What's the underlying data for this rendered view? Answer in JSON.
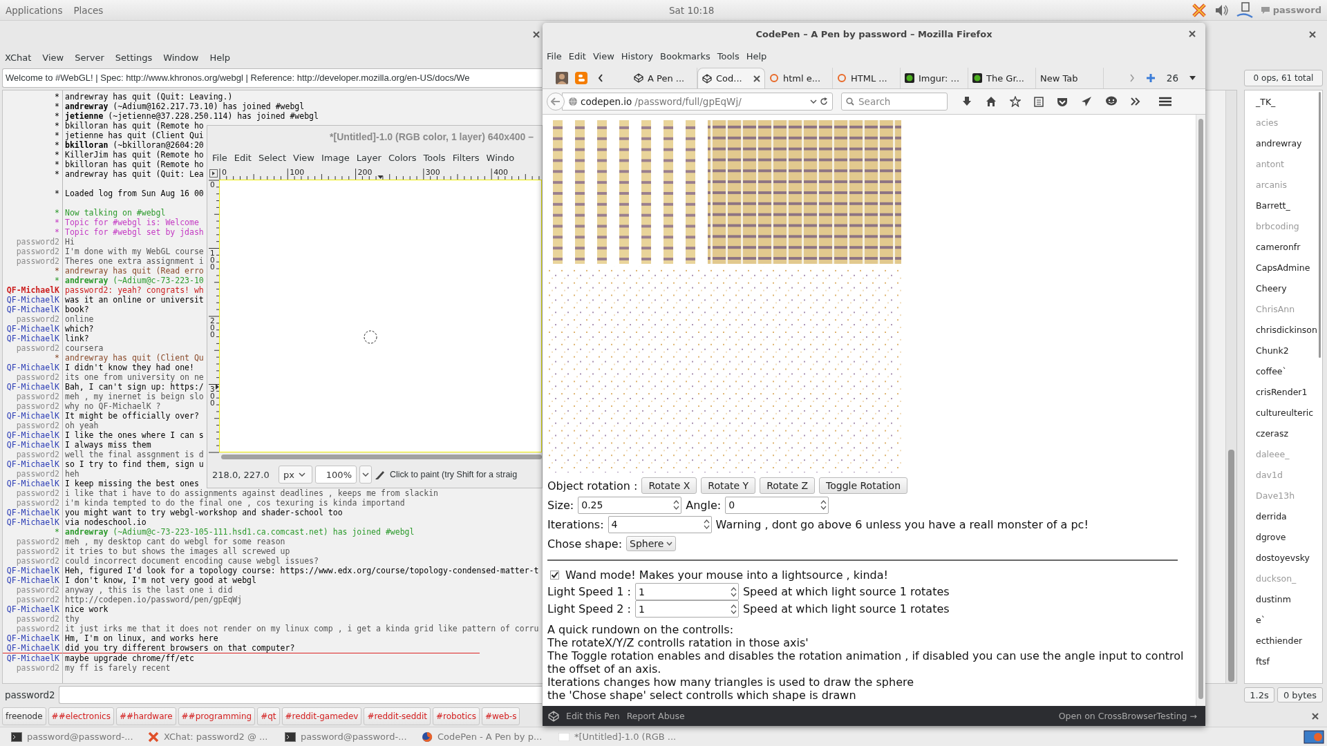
{
  "top_bar": {
    "menus": [
      "Applications",
      "Places"
    ],
    "clock": "Sat 10:18",
    "user": "password"
  },
  "xchat": {
    "menus": [
      "XChat",
      "View",
      "Server",
      "Settings",
      "Window",
      "Help"
    ],
    "topic": "Welcome to #WebGL! | Spec: http://www.khronos.org/webgl | Reference: http://developer.mozilla.org/en-US/docs/We",
    "nick_count": "0 ops, 61 total",
    "chat_lines": [
      {
        "kind": "event",
        "nick": "*",
        "text": "andrewray has quit (Quit: Leaving.)",
        "color": "#000000"
      },
      {
        "kind": "event",
        "nick": "*",
        "text": "**andrewray** (~Adium@162.217.73.10) has joined #webgl",
        "color": "#000000"
      },
      {
        "kind": "event",
        "nick": "*",
        "text": "**jetienne** (~jetienne@37.228.250.114) has joined #webgl",
        "color": "#000000"
      },
      {
        "kind": "event",
        "nick": "*",
        "text": "bkilloran has quit (Remote ho",
        "color": "#000000"
      },
      {
        "kind": "event",
        "nick": "*",
        "text": "jetienne has quit (Client Qui",
        "color": "#000000"
      },
      {
        "kind": "event",
        "nick": "*",
        "text": "**bkilloran** (~bkilloran@2604:20",
        "color": "#000000"
      },
      {
        "kind": "event",
        "nick": "*",
        "text": "KillerJim has quit (Remote ho",
        "color": "#000000"
      },
      {
        "kind": "event",
        "nick": "*",
        "text": "bkilloran has quit (Remote ho",
        "color": "#000000"
      },
      {
        "kind": "event",
        "nick": "*",
        "text": "andrewray has quit (Quit: Lea",
        "color": "#000000"
      },
      {
        "kind": "blank"
      },
      {
        "kind": "event",
        "nick": "*",
        "text": "Loaded log from Sun Aug 16 00",
        "color": "#000000"
      },
      {
        "kind": "blank"
      },
      {
        "kind": "event",
        "nick": "*",
        "text": "Now talking on #webgl",
        "color": "#2c9a2c"
      },
      {
        "kind": "event",
        "nick": "*",
        "text": "Topic for #webgl is: Welcome",
        "color": "#c43bc4"
      },
      {
        "kind": "event",
        "nick": "*",
        "text": "Topic for #webgl set by jdash",
        "color": "#c43bc4"
      },
      {
        "kind": "own",
        "nick": "password2",
        "text": "Hi"
      },
      {
        "kind": "own",
        "nick": "password2",
        "text": "I'm done with my WebGL course"
      },
      {
        "kind": "own",
        "nick": "password2",
        "text": "Theres one extra assignment i"
      },
      {
        "kind": "event",
        "nick": "*",
        "text": "andrewray has quit (Read erro",
        "color": "#8a4b2b"
      },
      {
        "kind": "event",
        "nick": "*",
        "text": "**andrewray** (~Adium@c-73-223-10",
        "color": "#2c9a2c"
      },
      {
        "kind": "highlight",
        "nick": "QF-MichaelK",
        "text": "password2: yeah? congrats! wh"
      },
      {
        "kind": "message",
        "nick": "QF-MichaelK",
        "text": "was it an online or universit"
      },
      {
        "kind": "message",
        "nick": "QF-MichaelK",
        "text": "book?"
      },
      {
        "kind": "own",
        "nick": "password2",
        "text": "online"
      },
      {
        "kind": "message",
        "nick": "QF-MichaelK",
        "text": "which?"
      },
      {
        "kind": "message",
        "nick": "QF-MichaelK",
        "text": "link?"
      },
      {
        "kind": "own",
        "nick": "password2",
        "text": "coursera"
      },
      {
        "kind": "event",
        "nick": "*",
        "text": "andrewray has quit (Client Qu",
        "color": "#8a4b2b"
      },
      {
        "kind": "message",
        "nick": "QF-MichaelK",
        "text": "I didn't know they had one!"
      },
      {
        "kind": "own",
        "nick": "password2",
        "text": "its one from university on ne"
      },
      {
        "kind": "message",
        "nick": "QF-MichaelK",
        "text": "Bah, I can't sign up: https:/"
      },
      {
        "kind": "own",
        "nick": "password2",
        "text": "meh , my inernet is beign slo"
      },
      {
        "kind": "own",
        "nick": "password2",
        "text": "why no QF-MichaelK ?"
      },
      {
        "kind": "message",
        "nick": "QF-MichaelK",
        "text": "It might be officially over?"
      },
      {
        "kind": "own",
        "nick": "password2",
        "text": "oh yeah"
      },
      {
        "kind": "message",
        "nick": "QF-MichaelK",
        "text": "I like the ones where I can s"
      },
      {
        "kind": "message",
        "nick": "QF-MichaelK",
        "text": "I always miss them"
      },
      {
        "kind": "own",
        "nick": "password2",
        "text": "well the final assgnment is d"
      },
      {
        "kind": "message",
        "nick": "QF-MichaelK",
        "text": "so I try to find them, sign u"
      },
      {
        "kind": "own",
        "nick": "password2",
        "text": "heh"
      },
      {
        "kind": "message",
        "nick": "QF-MichaelK",
        "text": "I keep missing the best ones"
      },
      {
        "kind": "own",
        "nick": "password2",
        "text": "i like that i have to do assignments against deadlines , keeps me from slackin"
      },
      {
        "kind": "own",
        "nick": "password2",
        "text": "i'm kinda tempted to do the final one , cos texuring is kinda importand"
      },
      {
        "kind": "message",
        "nick": "QF-MichaelK",
        "text": "you might want to try webgl-workshop and shader-school too"
      },
      {
        "kind": "message",
        "nick": "QF-MichaelK",
        "text": "via nodeschool.io"
      },
      {
        "kind": "event",
        "nick": "*",
        "text": "**andrewray** (~Adium@c-73-223-105-111.hsd1.ca.comcast.net) has joined #webgl",
        "color": "#2c9a2c"
      },
      {
        "kind": "own",
        "nick": "password2",
        "text": "meh , my desktop cant do webgl for some reason"
      },
      {
        "kind": "own",
        "nick": "password2",
        "text": "it tries to but shows the images all screwed up"
      },
      {
        "kind": "own",
        "nick": "password2",
        "text": "could incorrect document encoding cause webgl issues?"
      },
      {
        "kind": "message",
        "nick": "QF-MichaelK",
        "text": "Heh, figured I'd look for a topology course: https://www.edx.org/course/topology-condensed-matter-t"
      },
      {
        "kind": "message",
        "nick": "QF-MichaelK",
        "text": "I don't know, I'm not very good at webgl"
      },
      {
        "kind": "own",
        "nick": "password2",
        "text": "anyway , this is the last one i did"
      },
      {
        "kind": "own",
        "nick": "password2",
        "text": "http://codepen.io/password/pen/gpEqWj"
      },
      {
        "kind": "message",
        "nick": "QF-MichaelK",
        "text": "nice work"
      },
      {
        "kind": "own",
        "nick": "password2",
        "text": "thy"
      },
      {
        "kind": "own",
        "nick": "password2",
        "text": "it just irks me that it does not render on my linux comp , i get a kinda grid like pattern of corru"
      },
      {
        "kind": "message",
        "nick": "QF-MichaelK",
        "text": "Hm, I'm on linux, and works here"
      },
      {
        "kind": "message",
        "nick": "QF-MichaelK",
        "text": "did you try different browsers on that computer?"
      },
      {
        "kind": "marker"
      },
      {
        "kind": "message",
        "nick": "QF-MichaelK",
        "text": "maybe upgrade chrome/ff/etc"
      },
      {
        "kind": "own",
        "nick": "password2",
        "text": "my ff is farely recent"
      }
    ],
    "nicks": [
      {
        "name": "_TK_",
        "away": false
      },
      {
        "name": "acies",
        "away": true
      },
      {
        "name": "andrewray",
        "away": false
      },
      {
        "name": "antont",
        "away": true
      },
      {
        "name": "arcanis",
        "away": true
      },
      {
        "name": "Barrett_",
        "away": false
      },
      {
        "name": "brbcoding",
        "away": true
      },
      {
        "name": "cameronfr",
        "away": false
      },
      {
        "name": "CapsAdmine",
        "away": false
      },
      {
        "name": "Cheery",
        "away": false
      },
      {
        "name": "ChrisAnn",
        "away": true
      },
      {
        "name": "chrisdickinson",
        "away": false
      },
      {
        "name": "Chunk2",
        "away": false
      },
      {
        "name": "coffee`",
        "away": false
      },
      {
        "name": "crisRender1",
        "away": false
      },
      {
        "name": "cultureulteric",
        "away": false
      },
      {
        "name": "czerasz",
        "away": false
      },
      {
        "name": "daleee_",
        "away": true
      },
      {
        "name": "dav1d",
        "away": true
      },
      {
        "name": "Dave13h",
        "away": true
      },
      {
        "name": "derrida",
        "away": false
      },
      {
        "name": "dgrove",
        "away": false
      },
      {
        "name": "dostoyevsky",
        "away": false
      },
      {
        "name": "duckson_",
        "away": true
      },
      {
        "name": "dustinm",
        "away": false
      },
      {
        "name": "e`",
        "away": false
      },
      {
        "name": "ecthiender",
        "away": false
      },
      {
        "name": "ftsf",
        "away": false
      }
    ],
    "input_nick": "password2",
    "lag": "1.2s",
    "throughput": "0 bytes",
    "channels": [
      {
        "label": "freenode",
        "color": "#333333"
      },
      {
        "label": "##electronics",
        "color": "#d42020"
      },
      {
        "label": "##hardware",
        "color": "#d42020"
      },
      {
        "label": "##programming",
        "color": "#d42020"
      },
      {
        "label": "#qt",
        "color": "#d42020"
      },
      {
        "label": "#reddit-gamedev",
        "color": "#d42020"
      },
      {
        "label": "#reddit-seddit",
        "color": "#d42020"
      },
      {
        "label": "#robotics",
        "color": "#d42020"
      },
      {
        "label": "#web-s",
        "color": "#d42020"
      }
    ]
  },
  "gimp": {
    "title": "*[Untitled]-1.0 (RGB color, 1 layer) 640x400 –",
    "menus": [
      "File",
      "Edit",
      "Select",
      "View",
      "Image",
      "Layer",
      "Colors",
      "Tools",
      "Filters",
      "Windo"
    ],
    "h_ruler": [
      "0",
      "100",
      "200",
      "300",
      "400"
    ],
    "v_ruler": [
      "0",
      "100",
      "200",
      "300"
    ],
    "coords": "218.0, 227.0",
    "unit": "px",
    "zoom": "100%",
    "status": "Click to paint (try Shift for a straig"
  },
  "firefox": {
    "title": "CodePen – A Pen by password – Mozilla Firefox",
    "menus": [
      "File",
      "Edit",
      "View",
      "History",
      "Bookmarks",
      "Tools",
      "Help"
    ],
    "tabs": [
      {
        "label": "A Pen ...",
        "kind": "codepen",
        "selected": false
      },
      {
        "label": "Cod...",
        "kind": "codepen",
        "selected": true
      },
      {
        "label": "html e...",
        "kind": "ring",
        "selected": false
      },
      {
        "label": "HTML ...",
        "kind": "ring",
        "selected": false
      },
      {
        "label": "Imgur: ...",
        "kind": "green",
        "selected": false
      },
      {
        "label": "The Gr...",
        "kind": "green",
        "selected": false
      },
      {
        "label": "New Tab",
        "kind": "blank",
        "selected": false
      }
    ],
    "tab_count": "26",
    "url_host": "codepen.io",
    "url_path": "/password/full/gpEqWj/",
    "search_placeholder": "Search",
    "page": {
      "rotation_label": "Object rotation :",
      "rotation_buttons": [
        "Rotate X",
        "Rotate Y",
        "Rotate Z",
        "Toggle Rotation"
      ],
      "size_label": "Size:",
      "size_value": "0.25",
      "angle_label": "Angle:",
      "angle_value": "0",
      "iterations_label": "Iterations:",
      "iterations_value": "4",
      "warning": "Warning , dont go above 6 unless you have a reall monster of a pc!",
      "shape_label": "Chose shape:",
      "shape_value": "Sphere",
      "wand": {
        "label": "Wand mode! Makes your mouse into a lightsource , kinda!",
        "checked": true
      },
      "light_speeds": [
        {
          "label": "Light Speed 1 :",
          "value": "1",
          "hint": "Speed at which light source 1 rotates"
        },
        {
          "label": "Light Speed 2 :",
          "value": "1",
          "hint": "Speed at which light source 1 rotates"
        }
      ],
      "rundown": [
        "A quick rundown on the controlls:",
        "The rotateX/Y/Z controlls ratation in those axis'",
        "The Toggle rotation enables and disables the rotation animation , if disabled you can use the angle input to control the offset of an axis.",
        "Iterations changes how many triangles is used to draw the sphere",
        "the 'Chose shape' select controlls which shape is drawn"
      ]
    },
    "footer": {
      "links": [
        "Edit this Pen",
        "Report Abuse"
      ],
      "right": "Open on CrossBrowserTesting →"
    }
  },
  "taskbar": [
    {
      "kind": "terminal",
      "label": "password@password-..."
    },
    {
      "kind": "xchat",
      "label": "XChat: password2 @ ..."
    },
    {
      "kind": "terminal",
      "label": "password@password-..."
    },
    {
      "kind": "firefox",
      "label": "CodePen - A Pen by p..."
    },
    {
      "kind": "gimp",
      "label": "*[Untitled]-1.0 (RGB ..."
    }
  ]
}
